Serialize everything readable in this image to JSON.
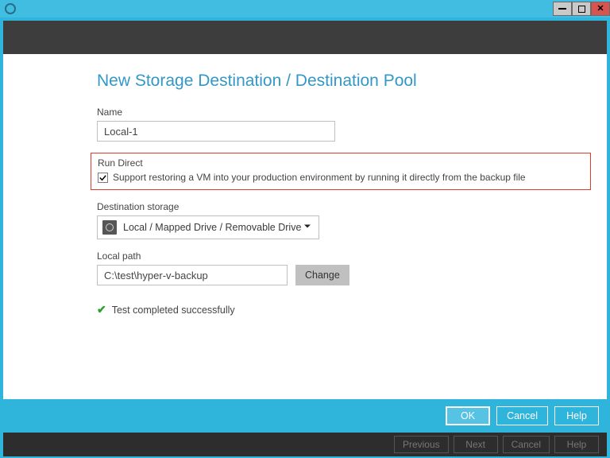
{
  "window": {
    "minimize": "–",
    "maximize": "",
    "close": "✕"
  },
  "page": {
    "title": "New Storage Destination / Destination Pool"
  },
  "name": {
    "label": "Name",
    "value": "Local-1"
  },
  "runDirect": {
    "label": "Run Direct",
    "checked": true,
    "text": "Support restoring a VM into your production environment by running it directly from the backup file"
  },
  "destStorage": {
    "label": "Destination storage",
    "value": "Local / Mapped Drive / Removable Drive"
  },
  "localPath": {
    "label": "Local path",
    "value": "C:\\test\\hyper-v-backup",
    "change": "Change"
  },
  "status": {
    "text": "Test completed successfully"
  },
  "dialog": {
    "ok": "OK",
    "cancel": "Cancel",
    "help": "Help"
  },
  "wizard": {
    "previous": "Previous",
    "next": "Next",
    "cancel": "Cancel",
    "help": "Help"
  }
}
